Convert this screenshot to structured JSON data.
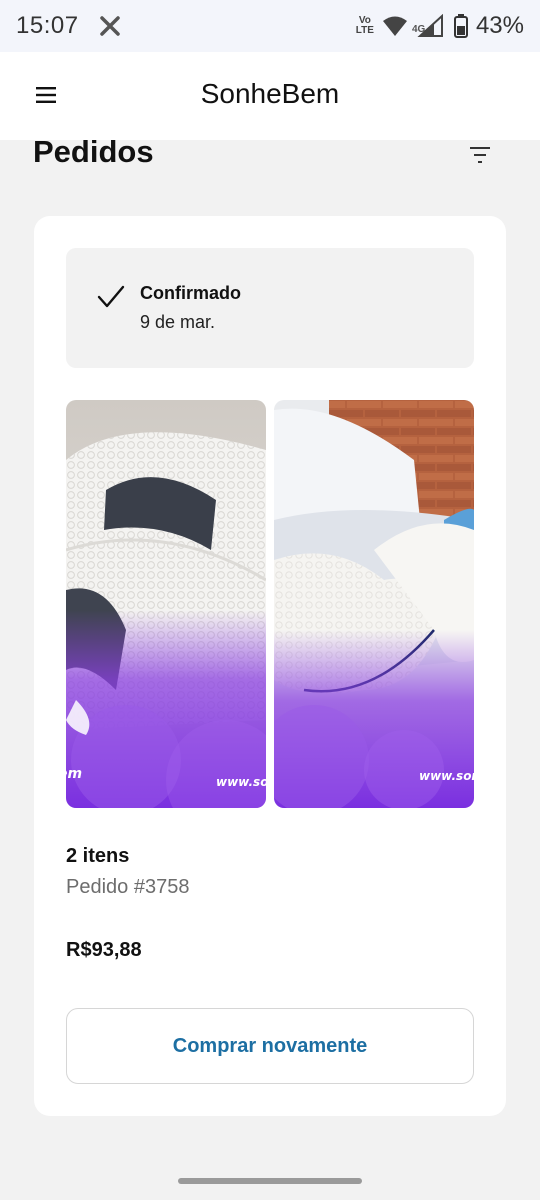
{
  "status_bar": {
    "time": "15:07",
    "volte_top": "Vo",
    "volte_bottom": "LTE",
    "network": "4G",
    "battery": "43%",
    "icons": [
      "x-app-icon",
      "wifi-icon",
      "signal-icon",
      "battery-icon"
    ]
  },
  "app_bar": {
    "title": "SonheBem",
    "menu_icon": "hamburger-menu-icon"
  },
  "page": {
    "title": "Pedidos",
    "filter_icon": "filter-icon"
  },
  "order": {
    "status": "Confirmado",
    "date": "9 de mar.",
    "status_icon": "checkmark-icon",
    "images": [
      {
        "name": "product-image-cervical-pillow",
        "caption": "www.son"
      },
      {
        "name": "product-image-knee-pillow",
        "caption": "www.son"
      }
    ],
    "items_count": "2 itens",
    "order_number": "Pedido #3758",
    "total": "R$93,88",
    "buy_again_label": "Comprar novamente"
  },
  "colors": {
    "accent": "#1d6fa3",
    "background": "#f2f2f2",
    "card": "#ffffff",
    "product_purple": "#8a3fe0"
  }
}
